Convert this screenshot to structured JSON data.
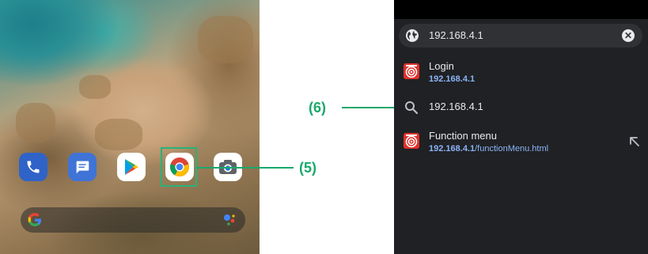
{
  "home": {
    "dock": [
      {
        "name": "phone"
      },
      {
        "name": "messages"
      },
      {
        "name": "play-store"
      },
      {
        "name": "chrome"
      },
      {
        "name": "camera"
      }
    ]
  },
  "callouts": {
    "five": "(5)",
    "six": "(6)"
  },
  "browser": {
    "url_value": "192.168.4.1",
    "suggestions": [
      {
        "title": "Login",
        "url_bold": "192.168.4.1",
        "url_rest": ""
      },
      {
        "query": "192.168.4.1"
      },
      {
        "title": "Function menu",
        "url_bold": "192.168.4.1",
        "url_rest": "/functionMenu.html"
      }
    ]
  },
  "colors": {
    "callout": "#1aa86b",
    "browser_bg": "#202124",
    "link": "#8ab4f8",
    "site_icon": "#e0302b"
  }
}
